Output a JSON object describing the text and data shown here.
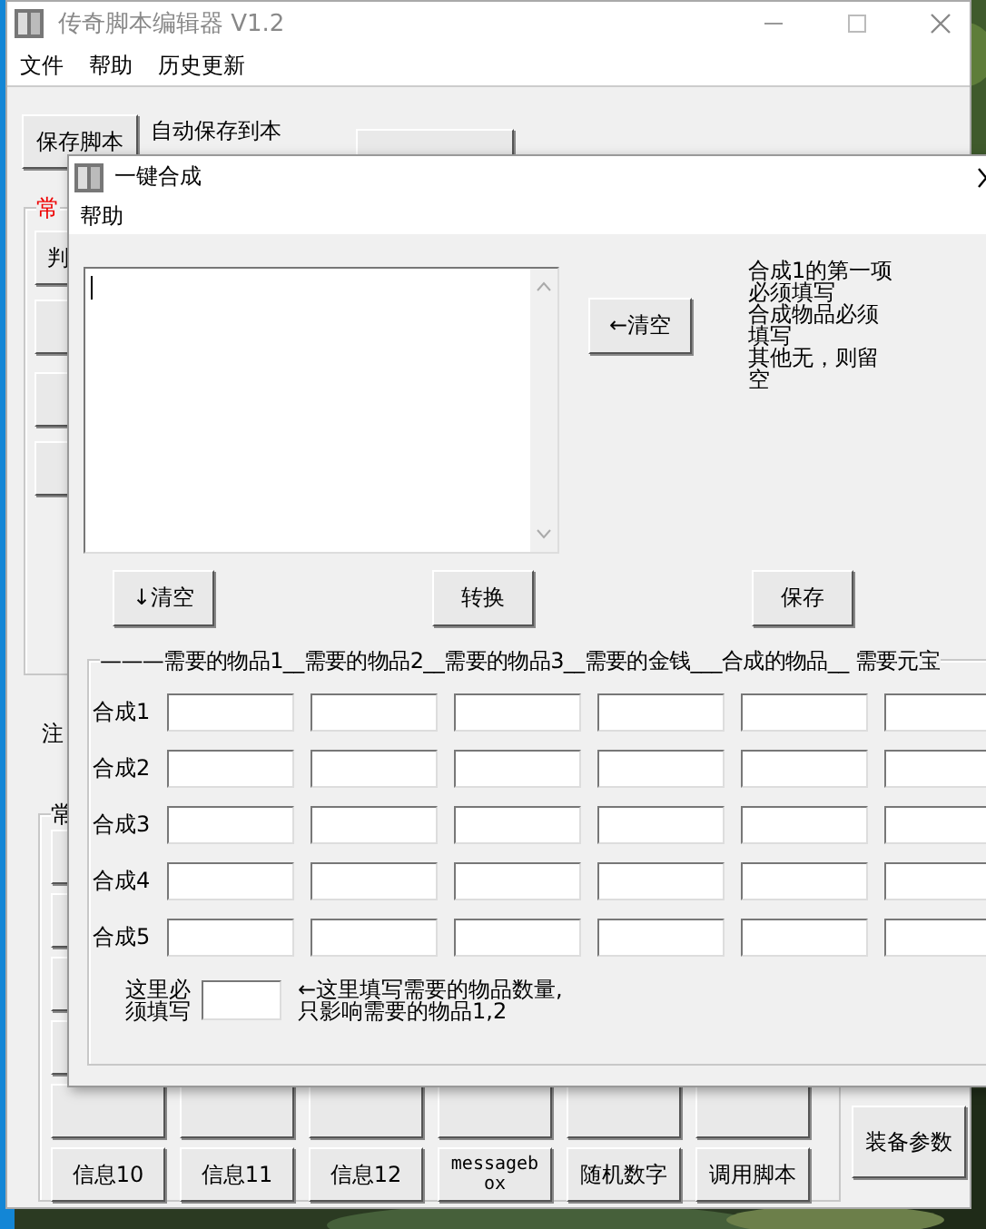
{
  "main_window": {
    "title": "传奇脚本编辑器 V1.2",
    "menu": [
      "文件",
      "帮助",
      "历史更新"
    ],
    "save_button": "保存脚本",
    "autosave_note": "自动保存到本",
    "common_group_legend": "常",
    "judge_button": "判",
    "comment_label": "注",
    "lower_group_legend": "常",
    "bottom_buttons": [
      "信息10",
      "信息11",
      "信息12",
      "messagebox",
      "随机数字",
      "调用脚本"
    ],
    "equipment_button": "装备参数"
  },
  "dialog": {
    "title": "一键合成",
    "menu": [
      "帮助"
    ],
    "clear_left_button": "←清空",
    "note_lines": [
      "合成1的第一项",
      "必须填写",
      "合成物品必须",
      "填写",
      "其他无，则留",
      "空"
    ],
    "buttons": [
      "↓清空",
      "转换",
      "保存"
    ],
    "legend": "———需要的物品1__需要的物品2__需要的物品3__需要的金钱___合成的物品__ 需要元宝",
    "rows": [
      {
        "label": "合成1"
      },
      {
        "label": "合成2"
      },
      {
        "label": "合成3"
      },
      {
        "label": "合成4"
      },
      {
        "label": "合成5"
      }
    ],
    "required_label_lines": [
      "这里必",
      "须填写"
    ],
    "quantity_hint_lines": [
      "←这里填写需要的物品数量,",
      "只影响需要的物品1,2"
    ]
  }
}
